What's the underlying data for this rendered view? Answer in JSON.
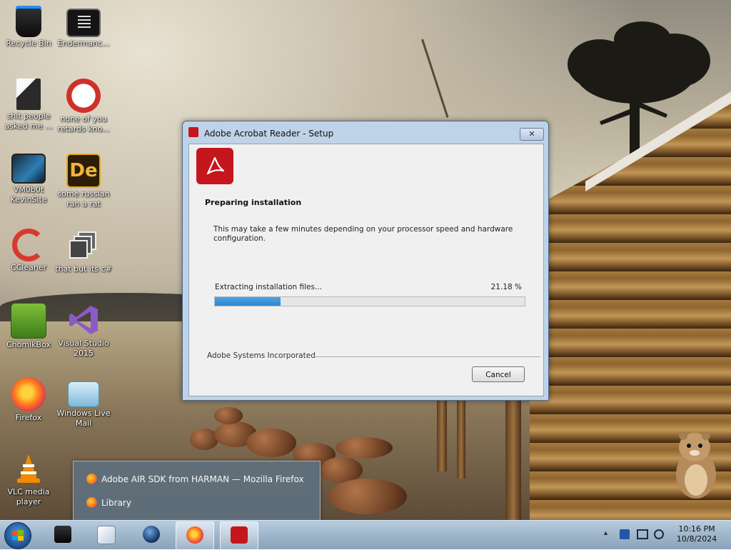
{
  "desktop_icons": [
    {
      "label": "Recycle Bin",
      "icon": "recycle-bin-icon"
    },
    {
      "label": "Endermanc...",
      "icon": "shortcut-icon"
    },
    {
      "label": "shit people asked me ...",
      "icon": "folder-icon"
    },
    {
      "label": "none of you retards kno...",
      "icon": "app-icon"
    },
    {
      "label": "VM0b0t KevinSite",
      "icon": "monitor-icon"
    },
    {
      "label": "some russian ran a rat",
      "icon": "de-icon"
    },
    {
      "label": "CCleaner",
      "icon": "ccleaner-icon"
    },
    {
      "label": "that but its c#",
      "icon": "windows-stack-icon"
    },
    {
      "label": "ChomikBox",
      "icon": "chomikbox-icon"
    },
    {
      "label": "Visual Studio 2015",
      "icon": "visual-studio-icon"
    },
    {
      "label": "Firefox",
      "icon": "firefox-icon"
    },
    {
      "label": "Windows Live Mail",
      "icon": "mail-icon"
    },
    {
      "label": "VLC media player",
      "icon": "vlc-icon"
    }
  ],
  "dialog": {
    "title": "Adobe Acrobat Reader - Setup",
    "close_label": "✕",
    "heading": "Preparing installation",
    "description": "This may take a few minutes depending on your processor speed and hardware configuration.",
    "status_text": "Extracting installation files...",
    "percent_text": "21.18 %",
    "progress": 0.2118,
    "company": "Adobe Systems Incorporated",
    "cancel_label": "Cancel",
    "accent": "#c4161c"
  },
  "popup": {
    "items": [
      {
        "label": "Adobe AIR SDK from HARMAN — Mozilla Firefox",
        "icon": "firefox-icon"
      },
      {
        "label": "Library",
        "icon": "firefox-icon"
      }
    ]
  },
  "taskbar": {
    "apps": [
      {
        "name": "terminal",
        "icon": "terminal-icon",
        "active": false
      },
      {
        "name": "media-player",
        "icon": "media-player-icon",
        "active": false
      },
      {
        "name": "globe",
        "icon": "globe-icon",
        "active": false
      },
      {
        "name": "firefox",
        "icon": "firefox-icon",
        "active": true
      },
      {
        "name": "acrobat",
        "icon": "acrobat-icon",
        "active": true
      }
    ],
    "tray_chevron": "▴",
    "time": "10:16 PM",
    "date": "10/8/2024"
  }
}
